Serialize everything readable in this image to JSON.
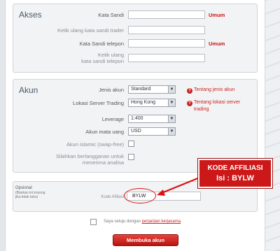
{
  "akses": {
    "title": "Akses",
    "password_label": "Kata Sandi",
    "password_badge": "Umum",
    "retype_trader_label": "Ketik ulang kata sandi trader",
    "phone_password_label": "Kata Sandi telepon",
    "phone_password_badge": "Umum",
    "retype_phone_label_1": "Ketik ulang",
    "retype_phone_label_2": "kata sandi telepon"
  },
  "akun": {
    "title": "Akun",
    "account_type_label": "Jenis akun",
    "account_type_value": "Standard",
    "account_type_help": "Tentang jenis akun",
    "server_label": "Lokasi Server Trading",
    "server_value": "Hong Kong",
    "server_help_1": "Tentang lokasi server",
    "server_help_2": "trading",
    "leverage_label": "Leverage",
    "leverage_value": "1:400",
    "currency_label": "Akun mata uang",
    "currency_value": "USD",
    "islamic_label": "Akun islamic (swap-free)",
    "subscribe_label_1": "Silahkan berlangganan untuk",
    "subscribe_label_2": "menerima analisa"
  },
  "optional": {
    "title": "Opsional",
    "note_1": "(Biarkan ini kosong",
    "note_2": "jika tidak tahu)",
    "affiliate_label": "Kode Afiliasi",
    "affiliate_value": "BYLW"
  },
  "callout": {
    "line1": "KODE AFFILIASI",
    "line2": "Isi  : BYLW"
  },
  "agreement": {
    "text": "Saya setuju dengan",
    "link": "perjanjian kerjasama"
  },
  "submit_label": "Membuka akun",
  "colors": {
    "accent_red": "#cc1111",
    "section_bg": "#f2f3f5"
  }
}
